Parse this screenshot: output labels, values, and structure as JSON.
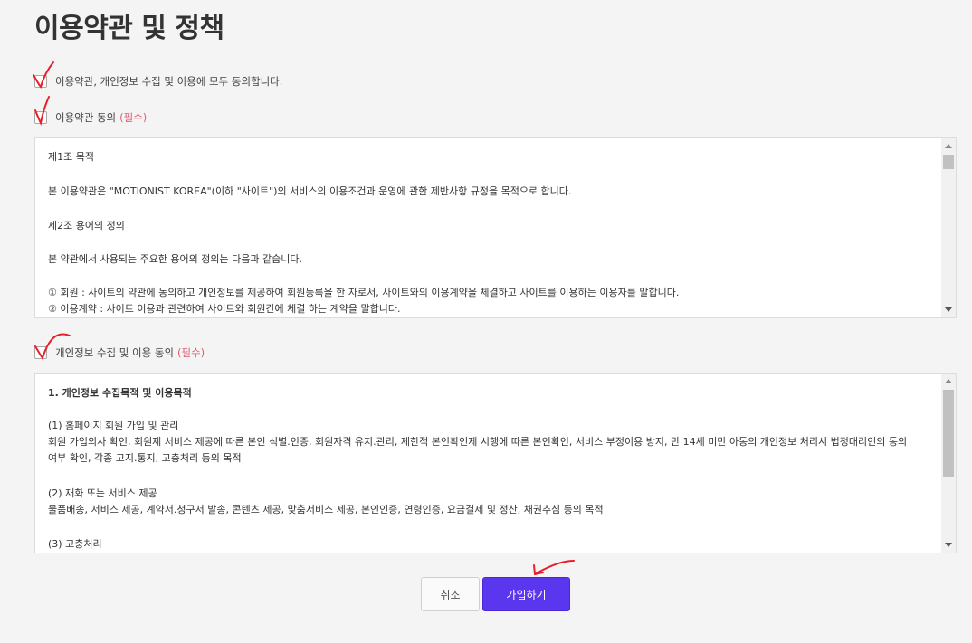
{
  "page_title": "이용약관 및 정책",
  "agree_all": {
    "label": "이용약관, 개인정보 수집 및 이용에 모두 동의합니다."
  },
  "terms": {
    "label": "이용약관 동의",
    "required": "(필수)",
    "content": [
      "제1조 목적",
      "본 이용약관은 \"MOTIONIST KOREA\"(이하 \"사이트\")의 서비스의 이용조건과 운영에 관한 제반사항 규정을 목적으로 합니다.",
      "제2조 용어의 정의",
      "본 약관에서 사용되는 주요한 용어의 정의는 다음과 같습니다.",
      "① 회원 : 사이트의 약관에 동의하고 개인정보를 제공하여 회원등록을 한 자로서, 사이트와의 이용계약을 체결하고 사이트를 이용하는 이용자를 말합니다.",
      "② 이용계약 : 사이트 이용과 관련하여 사이트와 회원간에 체결 하는 계약을 말합니다."
    ]
  },
  "privacy": {
    "label": "개인정보 수집 및 이용 동의",
    "required": "(필수)",
    "content": {
      "heading": "1. 개인정보 수집목적 및 이용목적",
      "s1_title": "(1) 홈페이지 회원 가입 및 관리",
      "s1_line1": "회원 가입의사 확인, 회원제 서비스 제공에 따른 본인 식별.인증, 회원자격 유지.관리, 제한적 본인확인제 시행에 따른 본인확인, 서비스 부정이용 방지, 만 14세 미만 아동의 개인정보 처리시 법정대리인의 동의",
      "s1_line2": "여부 확인, 각종 고지.통지, 고충처리 등의 목적",
      "s2_title": "(2) 재화 또는 서비스 제공",
      "s2_line1": "물품배송, 서비스 제공, 계약서.청구서 발송, 콘텐츠 제공, 맞춤서비스 제공, 본인인증, 연령인증, 요금결제 및 정산, 채권추심 등의 목적",
      "s3_title": "(3) 고충처리"
    }
  },
  "buttons": {
    "cancel": "취소",
    "join": "가입하기"
  },
  "colors": {
    "accent": "#5a36ee",
    "required": "#e05a6d",
    "annotation": "#e8202a"
  }
}
